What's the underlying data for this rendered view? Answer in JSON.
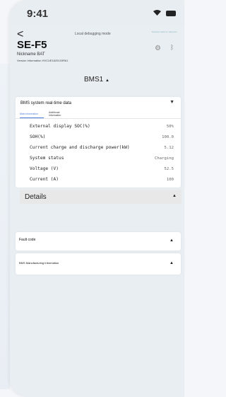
{
  "status_bar": {
    "time": "9:41",
    "wifi_icon": "wifi-icon",
    "battery_icon": "battery-icon"
  },
  "header": {
    "back_icon": "<",
    "mode": "Local debugging mode",
    "mode_badge": "Selected state for detection",
    "device_name": "SE-F5",
    "nickname": "Nickname BAT",
    "version": "Version Information HVCUE1625103R61",
    "gear_icon": "⚙",
    "bluetooth_icon": "ᛒ"
  },
  "bms_selector": {
    "value": "BMS1",
    "chevron": "▲"
  },
  "realtime": {
    "title": "BMS system real-time data",
    "chevron": "▼",
    "tabs": [
      {
        "label": "Main information"
      },
      {
        "label": "Additional information"
      }
    ],
    "rows": [
      {
        "label": "External display SOC(%)",
        "value": "50%"
      },
      {
        "label": "SOH(%)",
        "value": "100.0"
      },
      {
        "label": "Current charge and discharge power(kW)",
        "value": "5.12"
      },
      {
        "label": "System status",
        "value": "Charging"
      },
      {
        "label": "Voltage (V)",
        "value": "52.5"
      },
      {
        "label": "Current (A)",
        "value": "100"
      }
    ]
  },
  "details": {
    "label": "Details",
    "chevron": "▲"
  },
  "fault": {
    "title": "Fault code",
    "chevron": "▲"
  },
  "manufacturing": {
    "title": "BMS Manufacturing Information",
    "chevron": "▲"
  }
}
